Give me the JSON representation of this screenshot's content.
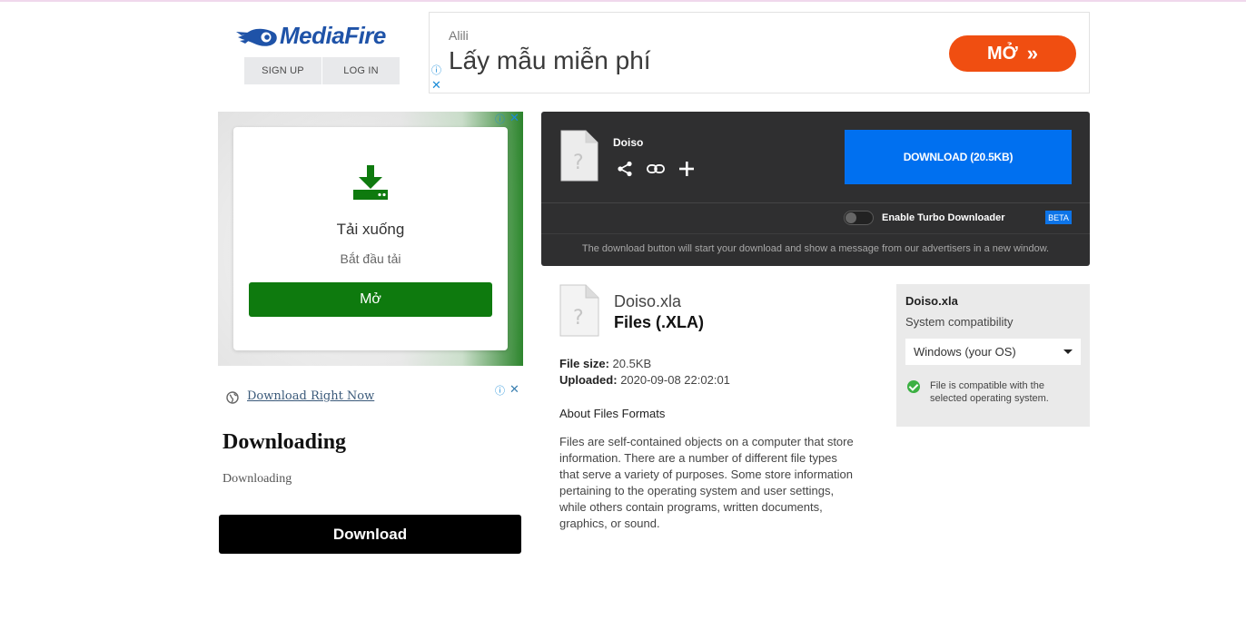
{
  "header": {
    "logo_text": "MediaFire",
    "sign_up": "SIGN UP",
    "log_in": "LOG IN"
  },
  "top_ad": {
    "advertiser": "Alili",
    "headline": "Lấy mẫu miễn phí",
    "cta": "MỞ",
    "cta_color": "#f04e11"
  },
  "left_ad": {
    "title": "Tải xuống",
    "subtitle": "Bắt đầu tải",
    "button": "Mở",
    "button_color": "#0e7a0e"
  },
  "left_ad2": {
    "link": "Download Right Now",
    "heading": "Downloading",
    "subtext": "Downloading",
    "button": "Download"
  },
  "download_panel": {
    "file_name": "Doiso",
    "download_button": "DOWNLOAD (20.5KB)",
    "turbo_label": "Enable Turbo Downloader",
    "beta_badge": "BETA",
    "note": "The download button will start your download and show a message from our advertisers in a new window.",
    "accent": "#0070f0"
  },
  "file_info": {
    "name": "Doiso.xla",
    "type": "Files (.XLA)",
    "size_label": "File size:",
    "size": "20.5KB",
    "uploaded_label": "Uploaded:",
    "uploaded": "2020-09-08 22:02:01",
    "about_heading": "About Files Formats",
    "about_text": "Files are self-contained objects on a computer that store information. There are a number of different file types that serve a variety of purposes. Some store information pertaining to the operating system and user settings, while others contain programs, written documents, graphics, or sound."
  },
  "compat": {
    "name": "Doiso.xla",
    "label": "System compatibility",
    "selected_os": "Windows (your OS)",
    "status": "File is compatible with the selected operating system."
  }
}
